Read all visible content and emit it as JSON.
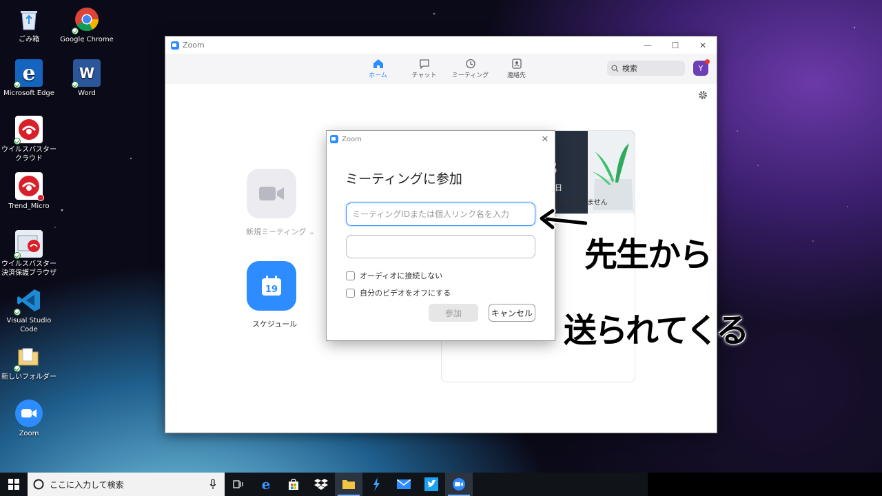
{
  "desktop": {
    "icons": [
      {
        "label": "ごみ箱"
      },
      {
        "label": "Google Chrome"
      },
      {
        "label": "Microsoft Edge"
      },
      {
        "label": "Word"
      },
      {
        "label": "ウイルスバスター クラウド"
      },
      {
        "label": "Trend_Micro"
      },
      {
        "label": "ウイルスバスター決済保護ブラウザ"
      },
      {
        "label": "Visual Studio Code"
      },
      {
        "label": "新しいフォルダー"
      },
      {
        "label": "Zoom"
      }
    ]
  },
  "zoom_window": {
    "title": "Zoom",
    "nav": [
      {
        "label": "ホーム",
        "icon": "home-icon",
        "active": true
      },
      {
        "label": "チャット",
        "icon": "chat-icon"
      },
      {
        "label": "ミーティング",
        "icon": "clock-icon"
      },
      {
        "label": "連絡先",
        "icon": "contacts-icon"
      }
    ],
    "search_placeholder": "検索",
    "avatar_letter": "Y",
    "new_meeting_label": "新規ミーティング",
    "schedule_label": "スケジュール",
    "schedule_day": "19",
    "card_digit": "3",
    "card_day_suffix": "日",
    "no_meetings_text": "ングはありません"
  },
  "dialog": {
    "title": "Zoom",
    "heading": "ミーティングに参加",
    "id_placeholder": "ミーティングIDまたは個人リンク名を入力",
    "name_value": "",
    "option_audio": "オーディオに接続しない",
    "option_video": "自分のビデオをオフにする",
    "join_label": "参加",
    "cancel_label": "キャンセル"
  },
  "annotation": {
    "line1": "先生から",
    "line2": "送られてくる"
  },
  "taskbar": {
    "search_text": "ここに入力して検索"
  },
  "colors": {
    "zoom_blue": "#2d8cff",
    "new_meeting_gray": "#ececf0",
    "avatar_purple": "#6c3fb5"
  }
}
